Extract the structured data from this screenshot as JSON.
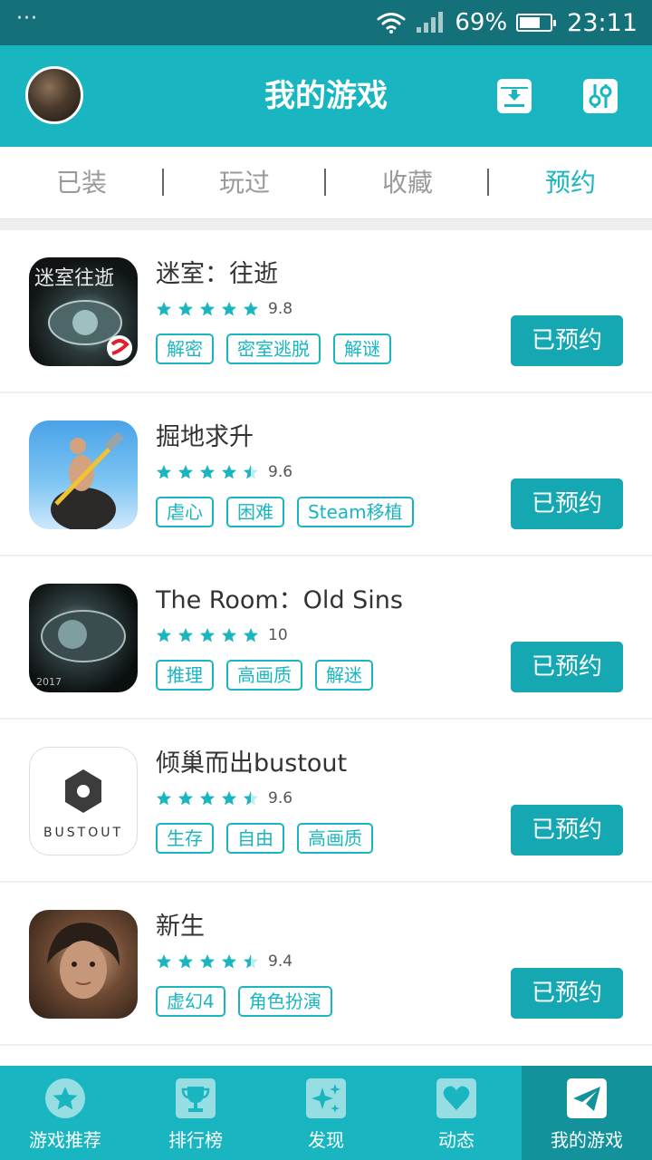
{
  "status_bar": {
    "dots": "···",
    "battery_percent": "69%",
    "battery_level": 0.69,
    "time": "23:11"
  },
  "header": {
    "title": "我的游戏"
  },
  "tabs": [
    {
      "label": "已装",
      "active": false
    },
    {
      "label": "玩过",
      "active": false
    },
    {
      "label": "收藏",
      "active": false
    },
    {
      "label": "预约",
      "active": true
    }
  ],
  "games": [
    {
      "name": "迷室：往逝",
      "rating": "9.8",
      "stars": 5,
      "tags": [
        "解密",
        "密室逃脱",
        "解谜"
      ],
      "button": "已预约",
      "icon_overlay": "迷室往逝"
    },
    {
      "name": "掘地求升",
      "rating": "9.6",
      "stars": 4.5,
      "tags": [
        "虐心",
        "困难",
        "Steam移植"
      ],
      "button": "已预约",
      "icon_overlay": ""
    },
    {
      "name": "The Room：Old Sins",
      "rating": "10",
      "stars": 5,
      "tags": [
        "推理",
        "高画质",
        "解迷"
      ],
      "button": "已预约",
      "icon_overlay": "2017"
    },
    {
      "name": "倾巢而出bustout",
      "rating": "9.6",
      "stars": 4.5,
      "tags": [
        "生存",
        "自由",
        "高画质"
      ],
      "button": "已预约",
      "icon_overlay": "BUSTOUT"
    },
    {
      "name": "新生",
      "rating": "9.4",
      "stars": 4.5,
      "tags": [
        "虚幻4",
        "角色扮演"
      ],
      "button": "已预约",
      "icon_overlay": ""
    }
  ],
  "bottom_nav": [
    {
      "label": "游戏推荐",
      "icon": "star-icon",
      "active": false
    },
    {
      "label": "排行榜",
      "icon": "trophy-icon",
      "active": false
    },
    {
      "label": "发现",
      "icon": "sparkle-icon",
      "active": false
    },
    {
      "label": "动态",
      "icon": "heart-icon",
      "active": false
    },
    {
      "label": "我的游戏",
      "icon": "paper-plane-icon",
      "active": true
    }
  ],
  "colors": {
    "accent": "#19b6c1",
    "status_bar": "#14717a",
    "button": "#16a8b2"
  }
}
